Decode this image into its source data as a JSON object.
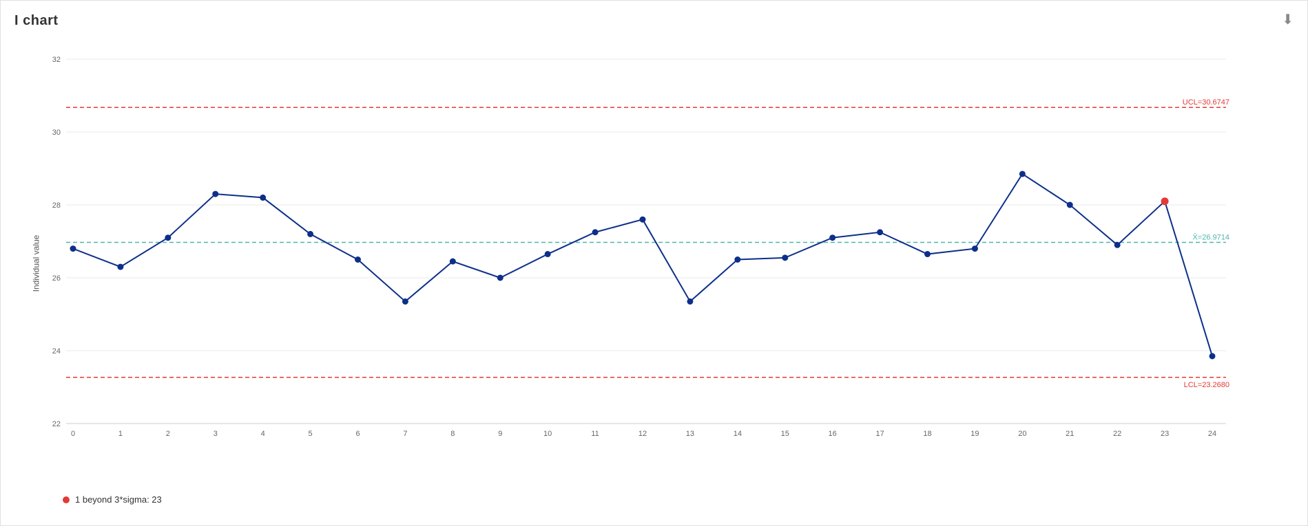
{
  "title": "I chart",
  "y_axis_label": "Individual value",
  "ucl": 30.6747,
  "lcl": 23.268,
  "mean": 26.9714,
  "ucl_label": "UCL=30.6747",
  "lcl_label": "LCL=23.2680",
  "mean_label": "X̄=26.9714",
  "legend_text": "1 beyond 3*sigma: 23",
  "download_icon": "⬇",
  "data_points": [
    {
      "x": 0,
      "y": 26.8
    },
    {
      "x": 1,
      "y": 26.3
    },
    {
      "x": 2,
      "y": 27.1
    },
    {
      "x": 3,
      "y": 28.3
    },
    {
      "x": 4,
      "y": 28.2
    },
    {
      "x": 5,
      "y": 27.2
    },
    {
      "x": 6,
      "y": 26.5
    },
    {
      "x": 7,
      "y": 25.35
    },
    {
      "x": 8,
      "y": 26.45
    },
    {
      "x": 9,
      "y": 26.0
    },
    {
      "x": 10,
      "y": 26.65
    },
    {
      "x": 11,
      "y": 27.25
    },
    {
      "x": 12,
      "y": 27.6
    },
    {
      "x": 13,
      "y": 25.35
    },
    {
      "x": 14,
      "y": 26.5
    },
    {
      "x": 15,
      "y": 26.55
    },
    {
      "x": 16,
      "y": 27.1
    },
    {
      "x": 17,
      "y": 27.25
    },
    {
      "x": 18,
      "y": 26.65
    },
    {
      "x": 19,
      "y": 26.8
    },
    {
      "x": 20,
      "y": 28.85
    },
    {
      "x": 21,
      "y": 28.0
    },
    {
      "x": 22,
      "y": 26.9
    },
    {
      "x": 23,
      "y": 28.1
    },
    {
      "x": 24,
      "y": 23.85
    }
  ],
  "outlier_points": [
    23
  ],
  "x_ticks": [
    0,
    1,
    2,
    3,
    4,
    5,
    6,
    7,
    8,
    9,
    10,
    11,
    12,
    13,
    14,
    15,
    16,
    17,
    18,
    19,
    20,
    21,
    22,
    23,
    24
  ],
  "y_ticks": [
    22,
    24,
    26,
    28,
    30,
    32
  ],
  "colors": {
    "line": "#0d2f8a",
    "ucl": "#e53935",
    "lcl": "#e53935",
    "mean": "#4db6ac",
    "dot_normal": "#0d2f8a",
    "dot_outlier": "#e53935",
    "axis": "#aaa"
  }
}
